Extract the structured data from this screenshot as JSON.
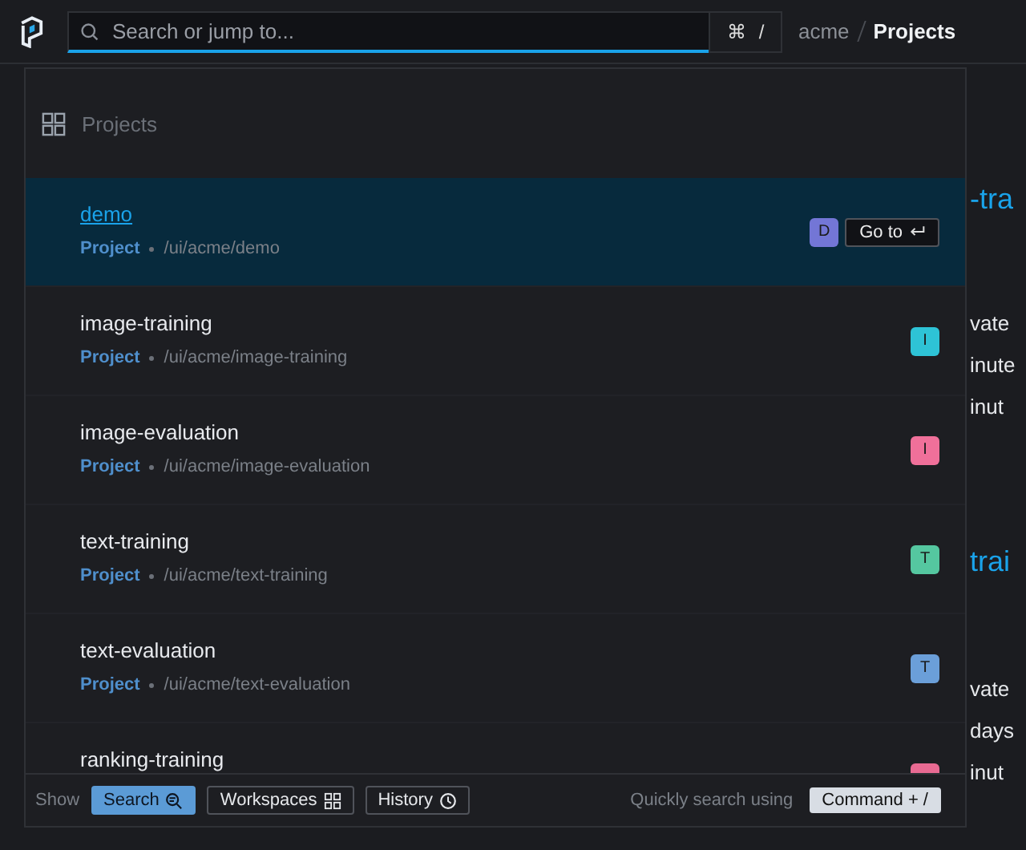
{
  "search": {
    "placeholder": "Search or jump to...",
    "shortcut": [
      "⌘",
      "/"
    ]
  },
  "breadcrumb": [
    {
      "label": "acme",
      "current": false
    },
    {
      "label": "Projects",
      "current": true
    }
  ],
  "background_fragments": [
    {
      "text": "-tra",
      "kind": "title"
    },
    {
      "text": "vate",
      "kind": "text"
    },
    {
      "text": "inute",
      "kind": "text"
    },
    {
      "text": "inut",
      "kind": "text"
    },
    {
      "text": "trai",
      "kind": "title"
    },
    {
      "text": "vate",
      "kind": "text"
    },
    {
      "text": "days",
      "kind": "text"
    },
    {
      "text": "inut",
      "kind": "text"
    }
  ],
  "palette": {
    "section_title": "Projects",
    "results": [
      {
        "name": "demo",
        "type": "Project",
        "path": "/ui/acme/demo",
        "badge": "D",
        "color": "#7376d6",
        "selected": true,
        "action": "Go to"
      },
      {
        "name": "image-training",
        "type": "Project",
        "path": "/ui/acme/image-training",
        "badge": "I",
        "color": "#2ec3d6",
        "selected": false
      },
      {
        "name": "image-evaluation",
        "type": "Project",
        "path": "/ui/acme/image-evaluation",
        "badge": "I",
        "color": "#f0709a",
        "selected": false
      },
      {
        "name": "text-training",
        "type": "Project",
        "path": "/ui/acme/text-training",
        "badge": "T",
        "color": "#55c7a0",
        "selected": false
      },
      {
        "name": "text-evaluation",
        "type": "Project",
        "path": "/ui/acme/text-evaluation",
        "badge": "T",
        "color": "#6b9fd9",
        "selected": false
      },
      {
        "name": "ranking-training",
        "color": "#e86a92",
        "selected": false
      }
    ],
    "footer": {
      "show_label": "Show",
      "filters": [
        {
          "label": "Search",
          "kind": "search",
          "selected": true
        },
        {
          "label": "Workspaces",
          "kind": "workspaces",
          "selected": false
        },
        {
          "label": "History",
          "kind": "history",
          "selected": false
        }
      ],
      "hint": "Quickly search using",
      "shortcut": "Command + /"
    }
  }
}
